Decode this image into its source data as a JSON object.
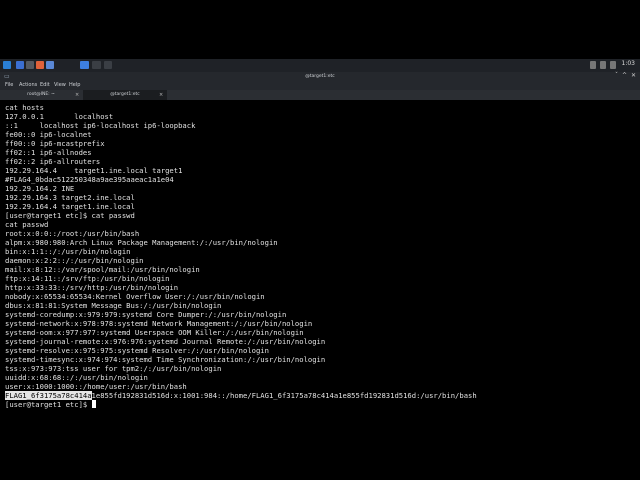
{
  "taskbar": {
    "clock": "1:03",
    "icons": [
      "kali-menu-icon",
      "folder-icon",
      "terminal-icon",
      "browser-icon",
      "settings-icon",
      "workspace-1-icon",
      "workspace-2-icon",
      "window-icon"
    ]
  },
  "window": {
    "title": "@target1:etc",
    "menu": [
      "File",
      "Actions",
      "Edit",
      "View",
      "Help"
    ],
    "tabs": [
      {
        "label": "root@INE: ~",
        "active": false
      },
      {
        "label": "@target1:etc",
        "active": true
      }
    ]
  },
  "terminal": {
    "lines": [
      "cat hosts",
      "127.0.0.1       localhost",
      "::1     localhost ip6-localhost ip6-loopback",
      "fe00::0 ip6-localnet",
      "ff00::0 ip6-mcastprefix",
      "ff02::1 ip6-allnodes",
      "ff02::2 ip6-allrouters",
      "192.29.164.4    target1.ine.local target1",
      "#FLAG4_0bdac512250348a9ae395aaeac1a1e04",
      "192.29.164.2 INE",
      "192.29.164.3 target2.ine.local",
      "192.29.164.4 target1.ine.local",
      "[user@target1 etc]$ cat passwd",
      "cat passwd",
      "root:x:0:0::/root:/usr/bin/bash",
      "alpm:x:980:980:Arch Linux Package Management:/:/usr/bin/nologin",
      "bin:x:1:1::/:/usr/bin/nologin",
      "daemon:x:2:2::/:/usr/bin/nologin",
      "mail:x:8:12::/var/spool/mail:/usr/bin/nologin",
      "ftp:x:14:11::/srv/ftp:/usr/bin/nologin",
      "http:x:33:33::/srv/http:/usr/bin/nologin",
      "nobody:x:65534:65534:Kernel Overflow User:/:/usr/bin/nologin",
      "dbus:x:81:81:System Message Bus:/:/usr/bin/nologin",
      "systemd-coredump:x:979:979:systemd Core Dumper:/:/usr/bin/nologin",
      "systemd-network:x:978:978:systemd Network Management:/:/usr/bin/nologin",
      "systemd-oom:x:977:977:systemd Userspace OOM Killer:/:/usr/bin/nologin",
      "systemd-journal-remote:x:976:976:systemd Journal Remote:/:/usr/bin/nologin",
      "systemd-resolve:x:975:975:systemd Resolver:/:/usr/bin/nologin",
      "systemd-timesync:x:974:974:systemd Time Synchronization:/:/usr/bin/nologin",
      "tss:x:973:973:tss user for tpm2:/:/usr/bin/nologin",
      "uuidd:x:68:68::/:/usr/bin/nologin",
      "user:x:1000:1000::/home/user:/usr/bin/bash"
    ],
    "flag_line": {
      "selected": "FLAG1_6f3175a78c414a",
      "rest": "1e855fd192831d516d:x:1001:984::/home/FLAG1_6f3175a78c414a1e855fd192831d516d:/usr/bin/bash"
    },
    "prompt": "[user@target1 etc]$ "
  }
}
